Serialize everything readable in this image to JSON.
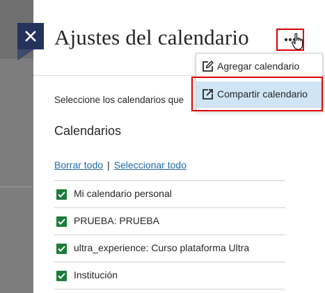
{
  "header": {
    "title": "Ajustes del calendario"
  },
  "content": {
    "instructions": "Seleccione los calendarios que",
    "section_title": "Calendarios",
    "links": {
      "clear_all": "Borrar todo",
      "separator": "|",
      "select_all": "Seleccionar todo"
    },
    "calendars": [
      {
        "label": "Mi calendario personal",
        "checked": true
      },
      {
        "label": "PRUEBA: PRUEBA",
        "checked": true
      },
      {
        "label": "ultra_experience: Curso plataforma Ultra",
        "checked": true
      },
      {
        "label": "Institución",
        "checked": true
      }
    ]
  },
  "menu": {
    "items": [
      {
        "label": "Agregar calendario",
        "icon": "edit-icon"
      },
      {
        "label": "Compartir calendario",
        "icon": "share-icon",
        "highlighted": true
      }
    ]
  },
  "colors": {
    "close_button": "#24325c",
    "checkbox": "#1c7c3a",
    "link": "#1f6aa8",
    "highlight_border": "#e00000",
    "menu_hover": "#cfe5f6"
  }
}
